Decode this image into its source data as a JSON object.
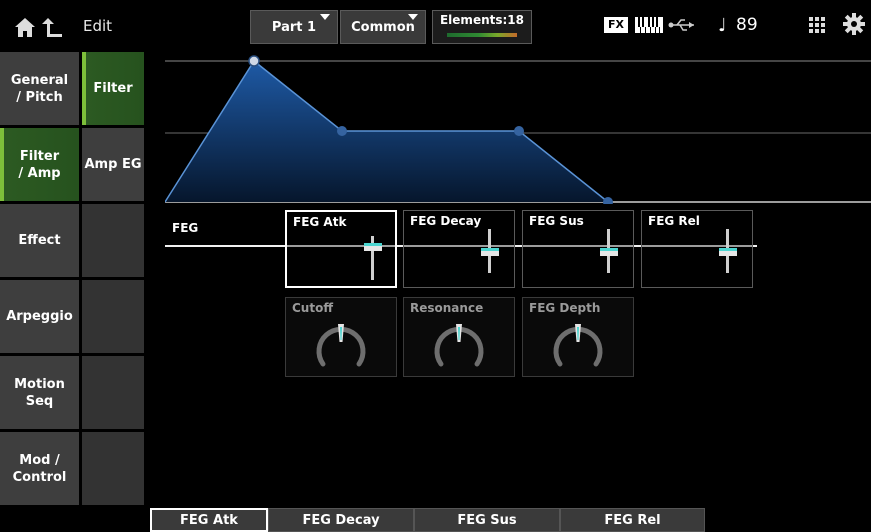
{
  "header": {
    "edit_label": "Edit",
    "part_label": "Part 1",
    "common_label": "Common",
    "elements_label": "Elements:18",
    "fx_label": "FX",
    "tempo_note": "♩",
    "tempo_value": "89"
  },
  "nav": {
    "items": [
      {
        "label": "General\n/ Pitch",
        "active": false
      },
      {
        "label": "Filter\n/ Amp",
        "active": true
      },
      {
        "label": "Effect",
        "active": false
      },
      {
        "label": "Arpeggio",
        "active": false
      },
      {
        "label": "Motion Seq",
        "active": false
      },
      {
        "label": "Mod /\nControl",
        "active": false
      }
    ],
    "sub_items": [
      {
        "label": "Filter",
        "active": true
      },
      {
        "label": "Amp EG",
        "active": false
      }
    ]
  },
  "feg": {
    "row_label": "FEG",
    "params": [
      {
        "label": "FEG Atk",
        "selected": true
      },
      {
        "label": "FEG Decay",
        "selected": false
      },
      {
        "label": "FEG Sus",
        "selected": false
      },
      {
        "label": "FEG Rel",
        "selected": false
      }
    ],
    "knobs": [
      {
        "label": "Cutoff"
      },
      {
        "label": "Resonance"
      },
      {
        "label": "FEG Depth"
      }
    ]
  },
  "tabs": [
    {
      "label": "FEG Atk",
      "selected": true
    },
    {
      "label": "FEG Decay",
      "selected": false
    },
    {
      "label": "FEG Sus",
      "selected": false
    },
    {
      "label": "FEG Rel",
      "selected": false
    }
  ],
  "colors": {
    "accent_green": "#7dbf3a",
    "slider_accent": "#4ad5d0",
    "graph_fill": "#1e5aa6"
  }
}
